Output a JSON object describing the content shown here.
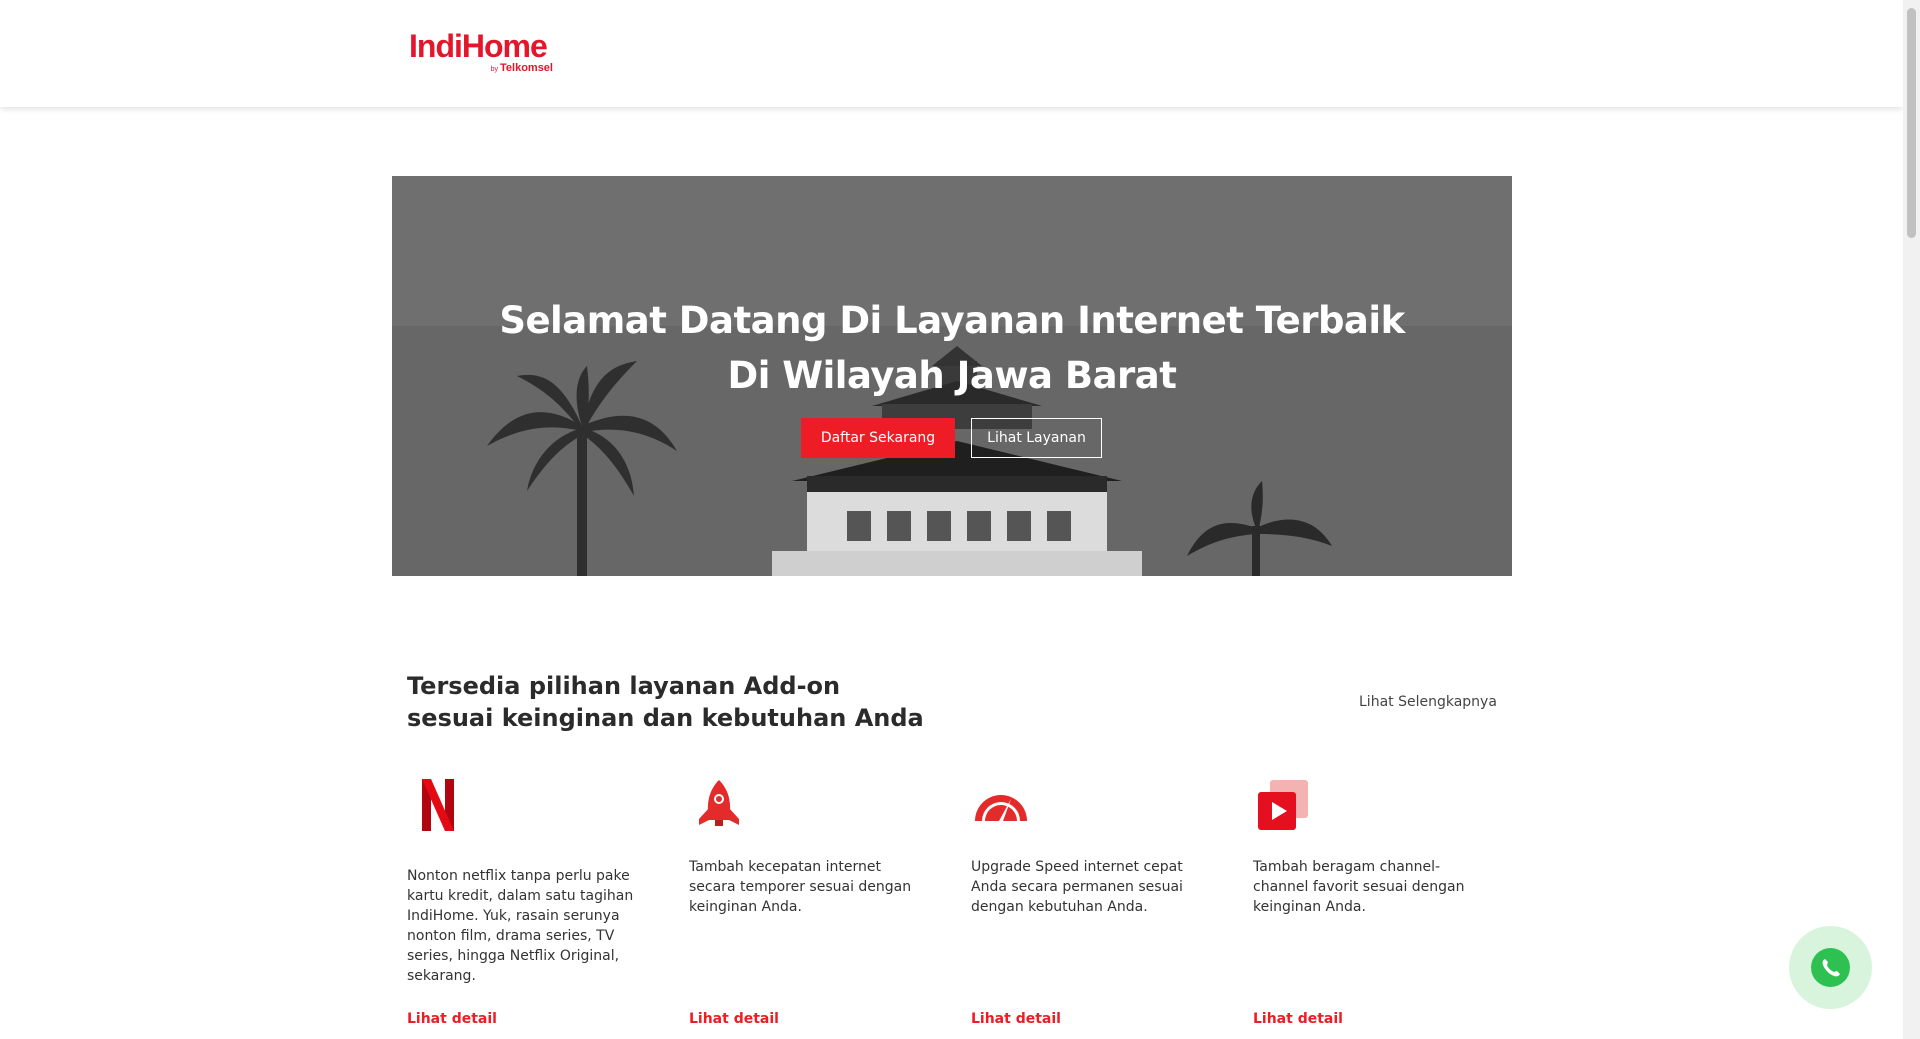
{
  "brand": {
    "name": "IndiHome",
    "sub_by": "by",
    "sub_name": "Telkomsel",
    "color": "#e3162b"
  },
  "hero": {
    "title_line1": "Selamat Datang Di Layanan Internet Terbaik",
    "title_line2": "Di Wilayah Jawa Barat",
    "primary_button": "Daftar Sekarang",
    "secondary_button": "Lihat Layanan"
  },
  "addons": {
    "title_line1": "Tersedia pilihan layanan Add-on",
    "title_line2": "sesuai keinginan dan kebutuhan Anda",
    "see_more": "Lihat Selengkapnya",
    "cards": [
      {
        "icon": "netflix-icon",
        "text": "Nonton netflix tanpa perlu pake kartu kredit, dalam satu tagihan IndiHome. Yuk, rasain serunya nonton film, drama series, TV series, hingga Netflix Original, sekarang.",
        "link": "Lihat detail"
      },
      {
        "icon": "rocket-icon",
        "text": "Tambah kecepatan internet secara temporer sesuai dengan keinginan Anda.",
        "link": "Lihat detail"
      },
      {
        "icon": "speedometer-icon",
        "text": "Upgrade Speed internet cepat Anda secara permanen sesuai dengan kebutuhan Anda.",
        "link": "Lihat detail"
      },
      {
        "icon": "play-channel-icon",
        "text": "Tambah beragam channel-channel favorit sesuai dengan keinginan Anda.",
        "link": "Lihat detail"
      }
    ]
  },
  "colors": {
    "accent": "#ee1c25",
    "whatsapp": "#2ec152"
  }
}
